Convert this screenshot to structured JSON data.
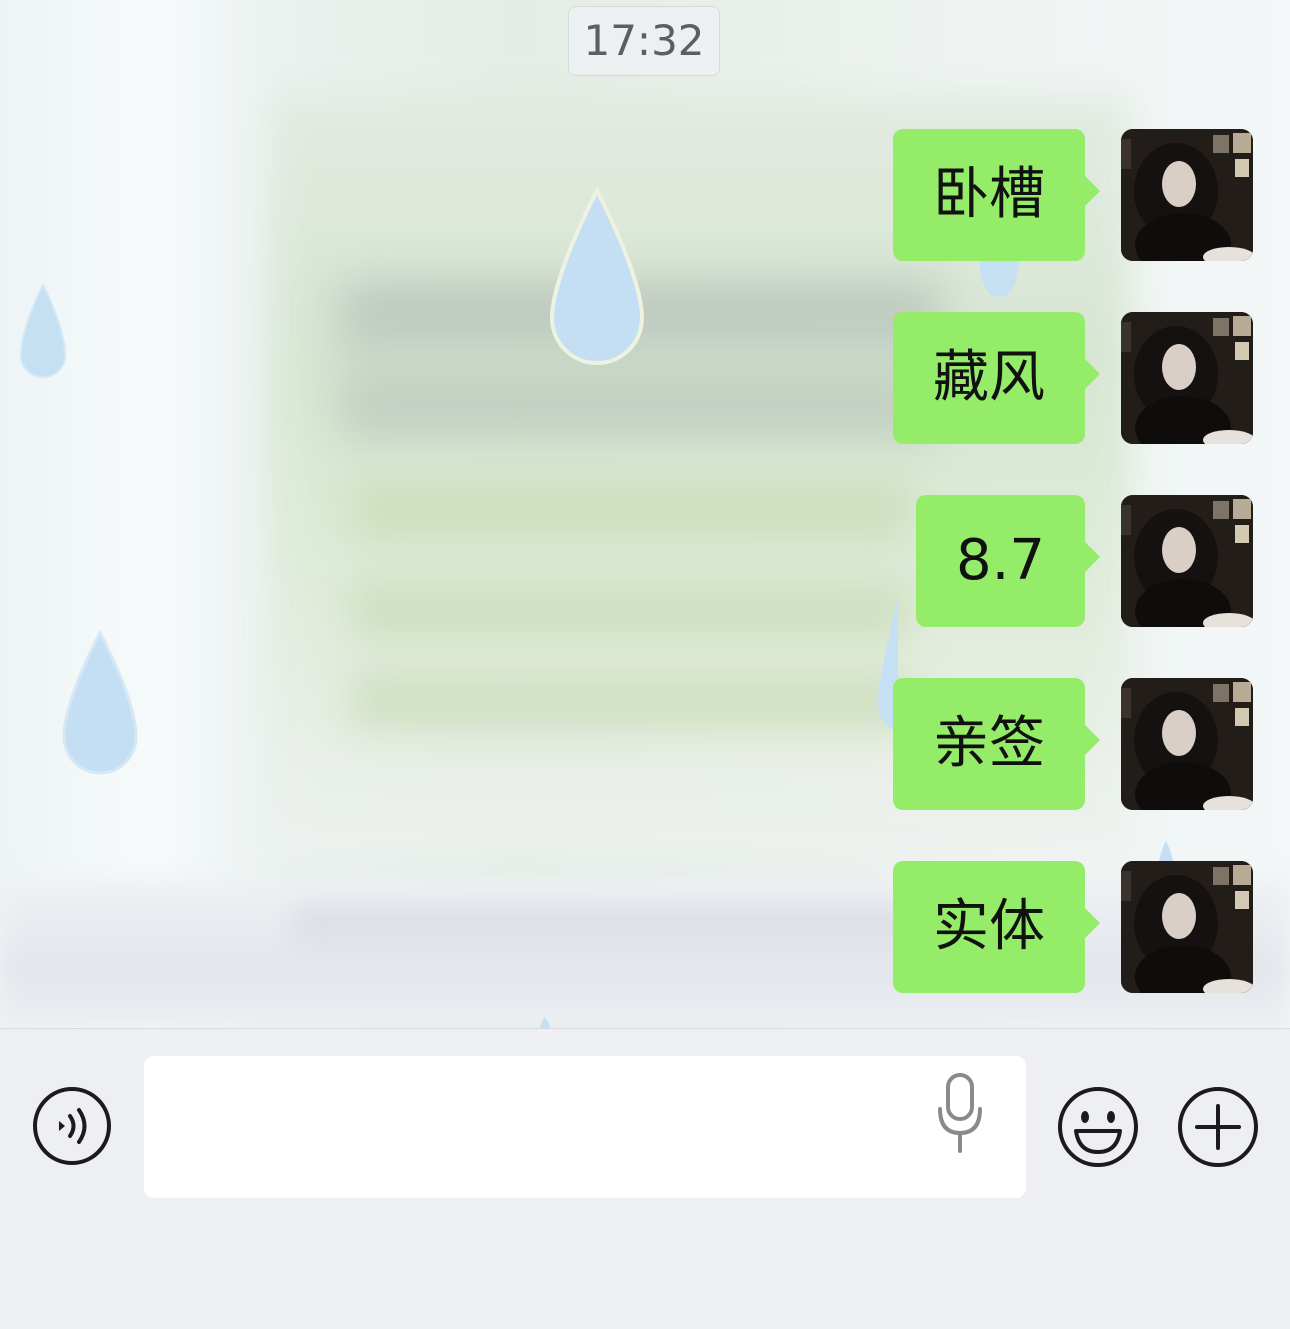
{
  "chat": {
    "timestamp": "17:32",
    "messages": [
      {
        "text": "卧槽",
        "sender": "self"
      },
      {
        "text": "藏风",
        "sender": "self"
      },
      {
        "text": "8.7",
        "sender": "self"
      },
      {
        "text": "亲签",
        "sender": "self"
      },
      {
        "text": "实体",
        "sender": "self"
      }
    ],
    "bubble_color": "#95ec69",
    "background_effect": "raindrops"
  },
  "input_bar": {
    "voice_icon": "voice-message-icon",
    "input_value": "",
    "mic_icon": "microphone-icon",
    "emoji_icon": "emoji-icon",
    "plus_icon": "plus-icon"
  }
}
